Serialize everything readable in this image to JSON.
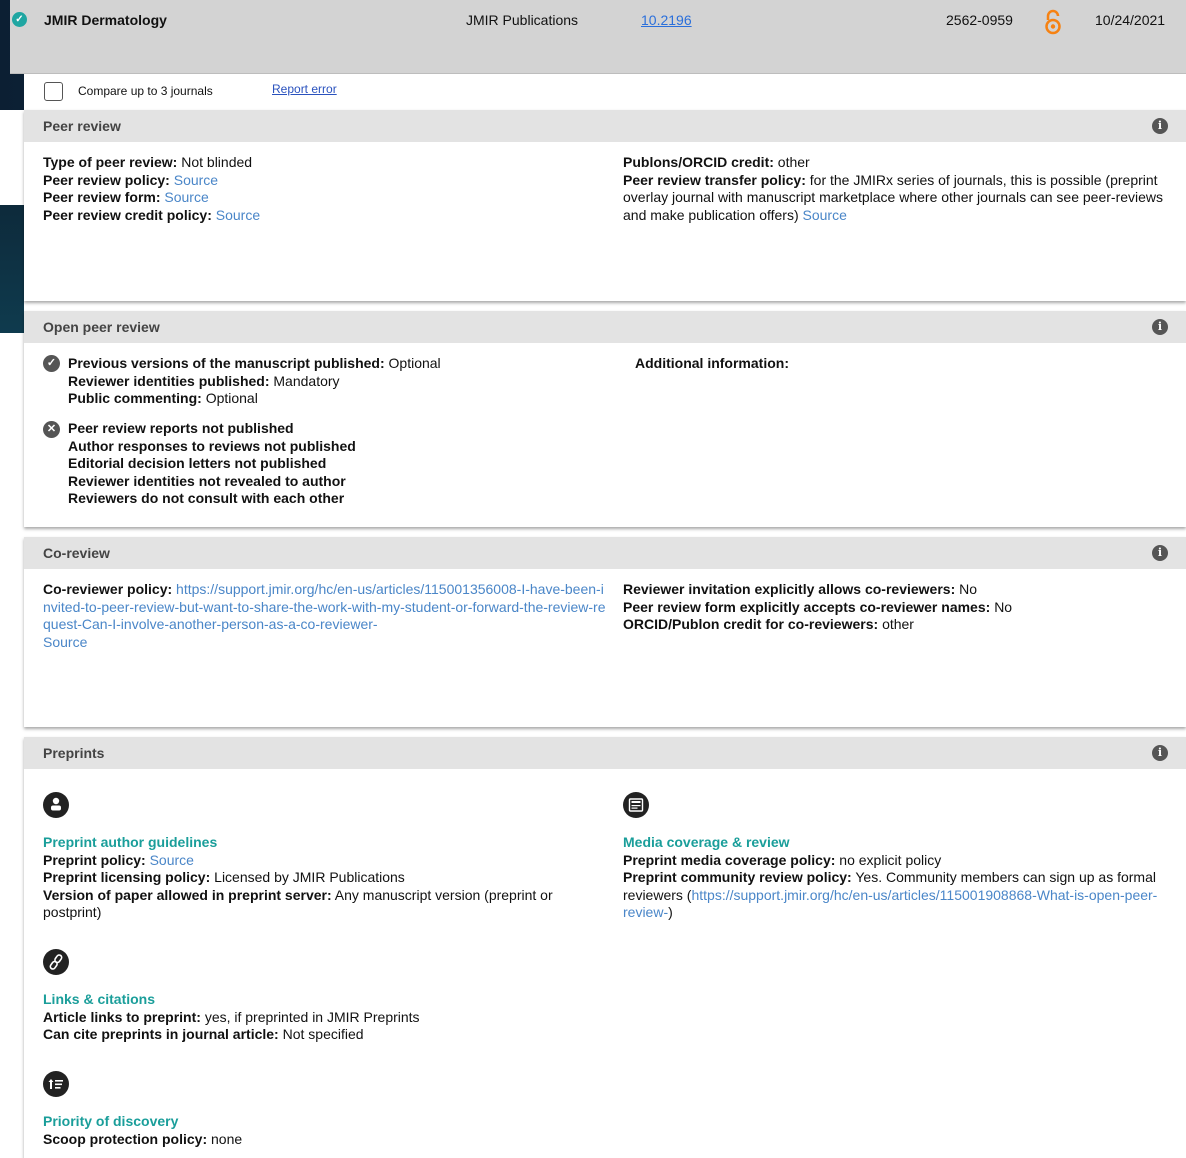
{
  "journal": {
    "name": "JMIR Dermatology",
    "publisher": "JMIR Publications",
    "doi": "10.2196",
    "issn": "2562-0959",
    "date": "10/24/2021",
    "open_access_icon": "open-access-icon",
    "verified_icon": "verified-check-icon"
  },
  "compare": {
    "label": "Compare up to 3 journals",
    "report": "Report error"
  },
  "peer_review": {
    "title": "Peer review",
    "left": [
      {
        "label": "Type of peer review:",
        "value": "Not blinded"
      },
      {
        "label": "Peer review policy:",
        "link": "Source"
      },
      {
        "label": "Peer review form:",
        "link": "Source"
      },
      {
        "label": "Peer review credit policy:",
        "link": "Source"
      }
    ],
    "right": {
      "publons_label": "Publons/ORCID credit:",
      "publons_value": "other",
      "transfer_label": "Peer review transfer policy:",
      "transfer_value": "for the JMIRx series of journals, this is possible (preprint overlay journal with manuscript marketplace where other journals can see peer-reviews and make publication offers)",
      "transfer_link": "Source"
    }
  },
  "open_peer_review": {
    "title": "Open peer review",
    "yes": [
      {
        "label": "Previous versions of the manuscript published:",
        "value": "Optional"
      },
      {
        "label": "Reviewer identities published:",
        "value": "Mandatory"
      },
      {
        "label": "Public commenting:",
        "value": "Optional"
      }
    ],
    "no": [
      "Peer review reports not published",
      "Author responses to reviews not published",
      "Editorial decision letters not published",
      "Reviewer identities not revealed to author",
      "Reviewers do not consult with each other"
    ],
    "additional": "Additional information:"
  },
  "co_review": {
    "title": "Co-review",
    "policy_label": "Co-reviewer policy:",
    "policy_url": "https://support.jmir.org/hc/en-us/articles/115001356008-I-have-been-invited-to-peer-review-but-want-to-share-the-work-with-my-student-or-forward-the-review-request-Can-I-involve-another-person-as-a-co-reviewer-",
    "policy_source": "Source",
    "right": [
      {
        "label": "Reviewer invitation explicitly allows co-reviewers:",
        "value": "No"
      },
      {
        "label": "Peer review form explicitly accepts co-reviewer names:",
        "value": "No"
      },
      {
        "label": "ORCID/Publon credit for co-reviewers:",
        "value": "other"
      }
    ]
  },
  "preprints": {
    "title": "Preprints",
    "guidelines": {
      "heading": "Preprint author guidelines",
      "policy_label": "Preprint policy:",
      "policy_link": "Source",
      "licensing_label": "Preprint licensing policy:",
      "licensing_value": "Licensed by JMIR Publications",
      "version_label": "Version of paper allowed in preprint server:",
      "version_value": "Any manuscript version (preprint or postprint)"
    },
    "links": {
      "heading": "Links & citations",
      "article_label": "Article links to preprint:",
      "article_value": "yes, if preprinted in JMIR Preprints",
      "cite_label": "Can cite preprints in journal article:",
      "cite_value": "Not specified"
    },
    "priority": {
      "heading": "Priority of discovery",
      "scoop_label": "Scoop protection policy:",
      "scoop_value": "none"
    },
    "media": {
      "heading": "Media coverage & review",
      "coverage_label": "Preprint media coverage policy:",
      "coverage_value": "no explicit policy",
      "community_label": "Preprint community review policy:",
      "community_value": "Yes. Community members can sign up as formal reviewers (",
      "community_link": "https://support.jmir.org/hc/en-us/articles/115001908868-What-is-open-peer-review-",
      "community_close": ")"
    }
  }
}
